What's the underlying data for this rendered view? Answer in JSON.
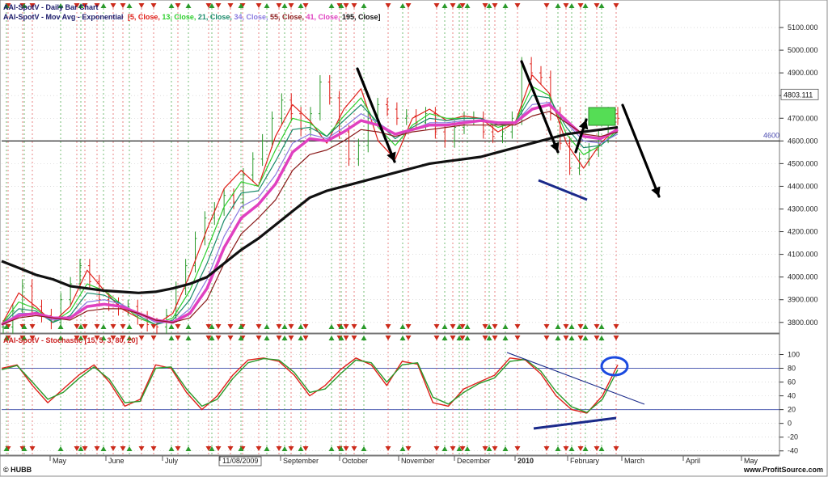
{
  "chart_data": [
    {
      "type": "bar",
      "title": "AAI-SpotV - Daily Bar Chart",
      "subtitle_prefix": "AAI-SpotV - Mov Avg - Exponential",
      "subtitle_items": [
        {
          "text": "[5, Close, ",
          "color": "#e0201a"
        },
        {
          "text": "13, Close, ",
          "color": "#2ccf2c"
        },
        {
          "text": "21, Close, ",
          "color": "#1a8a6a"
        },
        {
          "text": "34, Close, ",
          "color": "#8a7ae0"
        },
        {
          "text": "55, Close, ",
          "color": "#8a1a1a"
        },
        {
          "text": "41, Close, ",
          "color": "#e040c0"
        },
        {
          "text": "195, Close]",
          "color": "#111111"
        }
      ],
      "y_ticks": [
        "5100.000",
        "5000.000",
        "4900.000",
        "4800.000",
        "4700.000",
        "4600.000",
        "4500.000",
        "4400.000",
        "4300.000",
        "4200.000",
        "4100.000",
        "4000.000",
        "3900.000",
        "3800.000"
      ],
      "ylim": [
        3760,
        5150
      ],
      "last_value_label": "4803.111",
      "level_label": "4600",
      "level_value": 4600,
      "series": [
        {
          "name": "5, Close",
          "color": "#e0201a",
          "values": [
            3790,
            3930,
            3870,
            3800,
            3870,
            4030,
            3940,
            3860,
            3820,
            3790,
            3840,
            4010,
            4210,
            4390,
            4470,
            4400,
            4620,
            4760,
            4690,
            4590,
            4740,
            4830,
            4600,
            4520,
            4700,
            4740,
            4690,
            4710,
            4700,
            4640,
            4680,
            4890,
            4810,
            4590,
            4480,
            4590,
            4660
          ]
        },
        {
          "name": "13, Close",
          "color": "#2ccf2c",
          "values": [
            3790,
            3890,
            3860,
            3800,
            3850,
            3970,
            3940,
            3880,
            3820,
            3790,
            3820,
            3940,
            4120,
            4310,
            4420,
            4400,
            4560,
            4700,
            4680,
            4620,
            4710,
            4790,
            4660,
            4580,
            4670,
            4720,
            4700,
            4700,
            4700,
            4660,
            4680,
            4840,
            4800,
            4630,
            4540,
            4580,
            4650
          ]
        },
        {
          "name": "21, Close",
          "color": "#1a8a6a",
          "values": [
            3790,
            3860,
            3850,
            3800,
            3830,
            3930,
            3920,
            3880,
            3830,
            3790,
            3810,
            3900,
            4060,
            4250,
            4370,
            4380,
            4510,
            4650,
            4660,
            4620,
            4690,
            4760,
            4680,
            4610,
            4660,
            4700,
            4690,
            4700,
            4700,
            4670,
            4680,
            4800,
            4790,
            4660,
            4570,
            4580,
            4640
          ]
        },
        {
          "name": "34, Close",
          "color": "#8a7ae0",
          "values": [
            3790,
            3840,
            3840,
            3810,
            3820,
            3890,
            3900,
            3880,
            3840,
            3800,
            3800,
            3860,
            3990,
            4180,
            4310,
            4350,
            4450,
            4590,
            4630,
            4610,
            4660,
            4720,
            4680,
            4630,
            4650,
            4680,
            4680,
            4690,
            4690,
            4680,
            4680,
            4760,
            4770,
            4680,
            4600,
            4590,
            4630
          ]
        },
        {
          "name": "41, Close",
          "color": "#e040c0",
          "values": [
            3790,
            3830,
            3840,
            3820,
            3820,
            3870,
            3880,
            3870,
            3840,
            3810,
            3800,
            3840,
            3950,
            4130,
            4260,
            4320,
            4410,
            4550,
            4610,
            4600,
            4640,
            4690,
            4670,
            4630,
            4650,
            4670,
            4670,
            4680,
            4690,
            4680,
            4680,
            4740,
            4760,
            4690,
            4620,
            4610,
            4650
          ]
        },
        {
          "name": "55, Close",
          "color": "#8a1a1a",
          "values": [
            3790,
            3820,
            3830,
            3820,
            3810,
            3850,
            3860,
            3860,
            3840,
            3810,
            3800,
            3820,
            3900,
            4060,
            4190,
            4260,
            4340,
            4470,
            4540,
            4560,
            4600,
            4650,
            4640,
            4620,
            4640,
            4650,
            4660,
            4670,
            4670,
            4670,
            4670,
            4710,
            4730,
            4680,
            4630,
            4620,
            4640
          ]
        },
        {
          "name": "195, Close",
          "color": "#111111",
          "values": [
            4070,
            4040,
            4010,
            3990,
            3960,
            3950,
            3940,
            3935,
            3930,
            3935,
            3950,
            3970,
            4000,
            4060,
            4120,
            4170,
            4230,
            4290,
            4350,
            4380,
            4400,
            4420,
            4440,
            4460,
            4480,
            4500,
            4510,
            4520,
            4530,
            4550,
            4570,
            4590,
            4610,
            4630,
            4640,
            4650,
            4660
          ]
        }
      ],
      "bars_close": [
        3780,
        3850,
        3960,
        3870,
        3830,
        3800,
        3900,
        3970,
        4050,
        3980,
        3900,
        3880,
        3860,
        3870,
        3820,
        3790,
        3780,
        3830,
        3950,
        4050,
        4170,
        4260,
        4300,
        4360,
        4330,
        4450,
        4520,
        4600,
        4700,
        4780,
        4720,
        4650,
        4720,
        4860,
        4790,
        4640,
        4520,
        4580,
        4700,
        4760,
        4740,
        4700,
        4710,
        4680,
        4720,
        4640,
        4600,
        4660,
        4700,
        4700,
        4640,
        4620,
        4640,
        4700,
        4940,
        4900,
        4880,
        4720,
        4590,
        4480,
        4520,
        4560,
        4620,
        4720,
        4700
      ]
    },
    {
      "type": "line",
      "title": "AAI-SpotV - Stochastic [15, 5, 3, 80, 20]",
      "y_ticks": [
        "100",
        "80",
        "60",
        "40",
        "20",
        "0",
        "-20",
        "-40"
      ],
      "ylim": [
        -45,
        110
      ],
      "overbought": 80,
      "oversold": 20,
      "series": [
        {
          "name": "%K",
          "color": "#e0201a",
          "values": [
            80,
            85,
            55,
            30,
            50,
            70,
            85,
            60,
            25,
            35,
            85,
            80,
            45,
            20,
            40,
            70,
            92,
            95,
            90,
            70,
            40,
            55,
            78,
            95,
            85,
            55,
            90,
            86,
            30,
            25,
            50,
            60,
            70,
            95,
            92,
            72,
            40,
            20,
            15,
            40,
            85
          ]
        },
        {
          "name": "%D",
          "color": "#2a9a2a",
          "values": [
            78,
            84,
            60,
            35,
            45,
            65,
            82,
            64,
            30,
            32,
            80,
            82,
            50,
            25,
            35,
            65,
            88,
            94,
            92,
            74,
            45,
            50,
            72,
            92,
            88,
            60,
            85,
            88,
            38,
            28,
            45,
            58,
            66,
            90,
            93,
            76,
            46,
            24,
            16,
            35,
            78
          ]
        }
      ]
    }
  ],
  "x_labels": [
    "May",
    "June",
    "July",
    "11/08/2009",
    "September",
    "October",
    "November",
    "December",
    "2010",
    "February",
    "March",
    "April",
    "May"
  ],
  "x_label_bold": "2010",
  "footer_left": "HUBB",
  "footer_right": "www.ProfitSource.com",
  "colors": {
    "up_bar": "#2a9a2a",
    "down_bar": "#e0201a",
    "marker_green": "#2a9a2a",
    "marker_red": "#cc2a1a",
    "level_line": "#111111",
    "stoch_level": "#3a4aa8",
    "annotation_blue": "#1a2a8a",
    "annotation_box": "#55dd55",
    "grid": "#c8c8c8"
  }
}
